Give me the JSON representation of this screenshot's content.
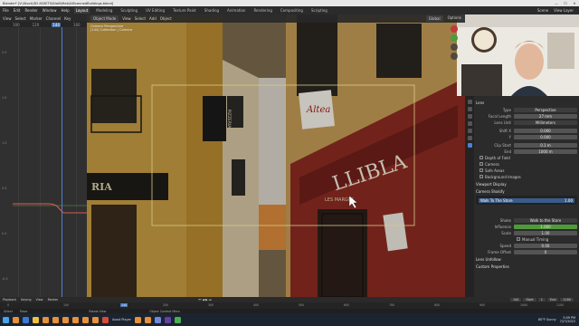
{
  "window": {
    "title": "Blender* [V:\\Stock\\3D ASSETS\\Stalli\\Mat\\AllScannedBuildings.blend]",
    "controls": [
      "—",
      "☐",
      "✕"
    ]
  },
  "menubar": {
    "menus": [
      "File",
      "Edit",
      "Render",
      "Window",
      "Help"
    ],
    "workspaces": [
      "Layout",
      "Modeling",
      "Sculpting",
      "UV Editing",
      "Texture Paint",
      "Shading",
      "Animation",
      "Rendering",
      "Compositing",
      "Scripting"
    ],
    "active_workspace": "Layout",
    "scene_label": "Scene",
    "view_layer_label": "View Layer"
  },
  "graph_editor": {
    "menus": [
      "View",
      "Select",
      "Marker",
      "Channel",
      "Key"
    ],
    "ruler": [
      "100",
      "120",
      "144",
      "160"
    ],
    "current_frame": "144",
    "y_labels": [
      "2.0",
      "1.5",
      "1.0",
      "0.5",
      "0.0",
      "-0.5"
    ]
  },
  "viewport": {
    "mode": "Object Mode",
    "menus": [
      "View",
      "Select",
      "Add",
      "Object"
    ],
    "transform_orientation": "Global",
    "camera_label": "Camera Perspective",
    "object_label": "(144) Collection | Camera",
    "signs": {
      "pizzeria": "PIZZERIA",
      "ria": "RIA",
      "store": "LLIBLA",
      "altea": "Altea",
      "les_marges": "LES MARGES"
    },
    "right_header": "Options"
  },
  "properties": {
    "section_lens": "Lens",
    "type_label": "Type",
    "type_value": "Perspective",
    "focal_label": "Focal Length",
    "focal_value": "27 mm",
    "lens_unit_label": "Lens Unit",
    "lens_unit_value": "Millimeters",
    "shift_x_label": "Shift X",
    "shift_x_value": "0.000",
    "shift_y_label": "Y",
    "shift_y_value": "0.000",
    "clip_start_label": "Clip Start",
    "clip_start_value": "0.1 m",
    "clip_end_label": "End",
    "clip_end_value": "1000 m",
    "checks": [
      "Depth of Field",
      "Camera",
      "Safe Areas",
      "Background Images"
    ],
    "section_display": "Viewport Display",
    "section_shake": "Camera Shakify",
    "shake_item": "Walk To The Store",
    "shake_item_value": "1.00",
    "shake_label": "Shake",
    "shake_value": "Walk to the Store",
    "influence_label": "Influence",
    "influence_value": "1.000",
    "scale_label": "Scale",
    "scale_value": "1.00",
    "manual_timing": "Manual Timing",
    "speed_label": "Speed",
    "speed_value": "0.00",
    "frame_offset_label": "Frame Offset",
    "frame_offset_value": "0",
    "section_more": "Lens Unfollow",
    "section_custom": "Custom Properties"
  },
  "timeline": {
    "menus": [
      "Playback",
      "Keying",
      "View",
      "Marker"
    ],
    "current": "144",
    "start_label": "Start",
    "start": "1",
    "end_label": "End",
    "end": "1180",
    "ticks": [
      "0",
      "100",
      "144",
      "200",
      "300",
      "400",
      "500",
      "600",
      "700",
      "800",
      "900",
      "1000",
      "1100"
    ]
  },
  "statusbar": {
    "items": [
      "Select",
      "Move",
      "Rotate View",
      "Object Context Menu"
    ]
  },
  "taskbar": {
    "weather": "80°F  Sunny",
    "time": "5:09 PM",
    "date": "7/27/2022",
    "app_label": "Avast Player"
  },
  "colors": {
    "accent": "#4772b3",
    "wall_yellow": "#c8a24a",
    "store_red": "#8a2b22",
    "green_value": "#4f9a3a"
  }
}
